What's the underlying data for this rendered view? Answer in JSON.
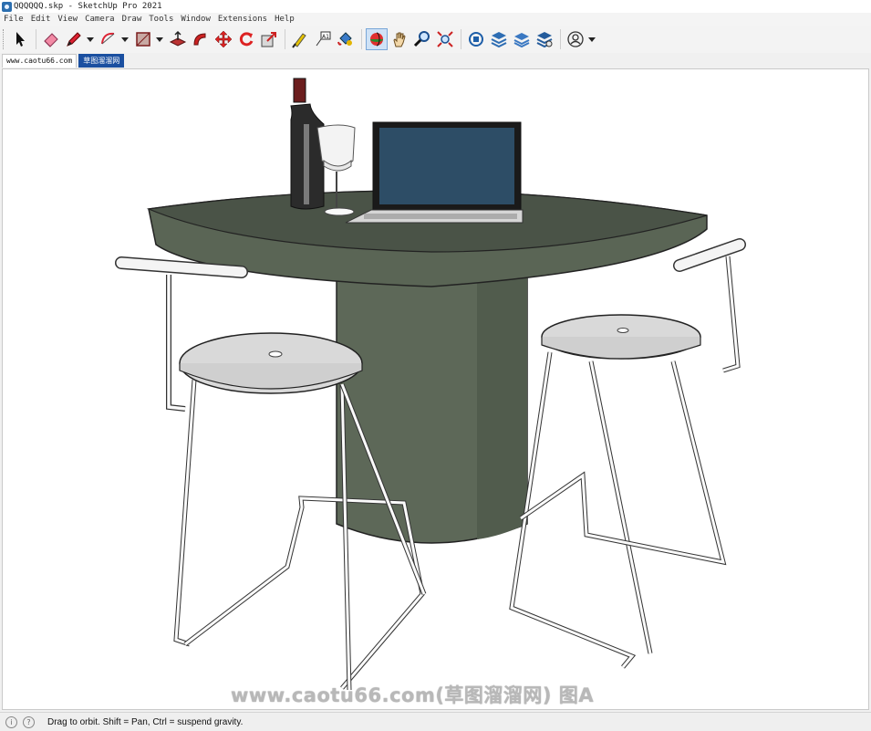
{
  "window": {
    "title": "QQQQQQ.skp - SketchUp Pro 2021"
  },
  "menu": [
    "File",
    "Edit",
    "View",
    "Camera",
    "Draw",
    "Tools",
    "Window",
    "Extensions",
    "Help"
  ],
  "toolbar": {
    "tools": [
      {
        "name": "select-tool",
        "icon": "arrow-icon"
      },
      {
        "name": "eraser-tool",
        "icon": "eraser-icon"
      },
      {
        "name": "pencil-tool",
        "icon": "pencil-icon",
        "dropdown": true
      },
      {
        "name": "arc-tool",
        "icon": "arc-icon",
        "dropdown": true
      },
      {
        "name": "rectangle-tool",
        "icon": "rectangle-icon",
        "dropdown": true
      },
      {
        "name": "pushpull-tool",
        "icon": "pushpull-icon"
      },
      {
        "name": "followme-tool",
        "icon": "followme-icon"
      },
      {
        "name": "move-tool",
        "icon": "move-icon"
      },
      {
        "name": "rotate-tool",
        "icon": "rotate-icon"
      },
      {
        "name": "scale-tool",
        "icon": "scale-icon"
      },
      {
        "name": "tape-tool",
        "icon": "tape-measure-icon"
      },
      {
        "name": "text-tool",
        "icon": "text-label-icon"
      },
      {
        "name": "paint-tool",
        "icon": "paint-bucket-icon"
      },
      {
        "name": "orbit-tool",
        "icon": "orbit-icon",
        "active": true
      },
      {
        "name": "pan-tool",
        "icon": "hand-icon"
      },
      {
        "name": "zoom-tool",
        "icon": "magnifier-icon"
      },
      {
        "name": "zoom-extents-tool",
        "icon": "zoom-extents-icon"
      },
      {
        "name": "warehouse-tool",
        "icon": "3d-warehouse-icon"
      },
      {
        "name": "extension-warehouse-tool",
        "icon": "extension-warehouse-icon"
      },
      {
        "name": "layers-tool",
        "icon": "layers-icon"
      },
      {
        "name": "extension-manager-tool",
        "icon": "extension-manager-icon"
      },
      {
        "name": "account-tool",
        "icon": "user-icon",
        "dropdown": true
      }
    ]
  },
  "tabs": [
    {
      "label": "www.caotu66.com",
      "active": false
    },
    {
      "label": "草图溜溜网",
      "active": true
    }
  ],
  "watermark": "www.caotu66.com(草图溜溜网) 图A",
  "status": {
    "text": "Drag to orbit. Shift = Pan, Ctrl = suspend gravity.",
    "icon1": "i",
    "icon2": "?"
  },
  "colors": {
    "table": "#5d6858",
    "table_top": "#4a5347",
    "screen": "#2d4d66",
    "stool_seat": "#d9d9d9"
  }
}
